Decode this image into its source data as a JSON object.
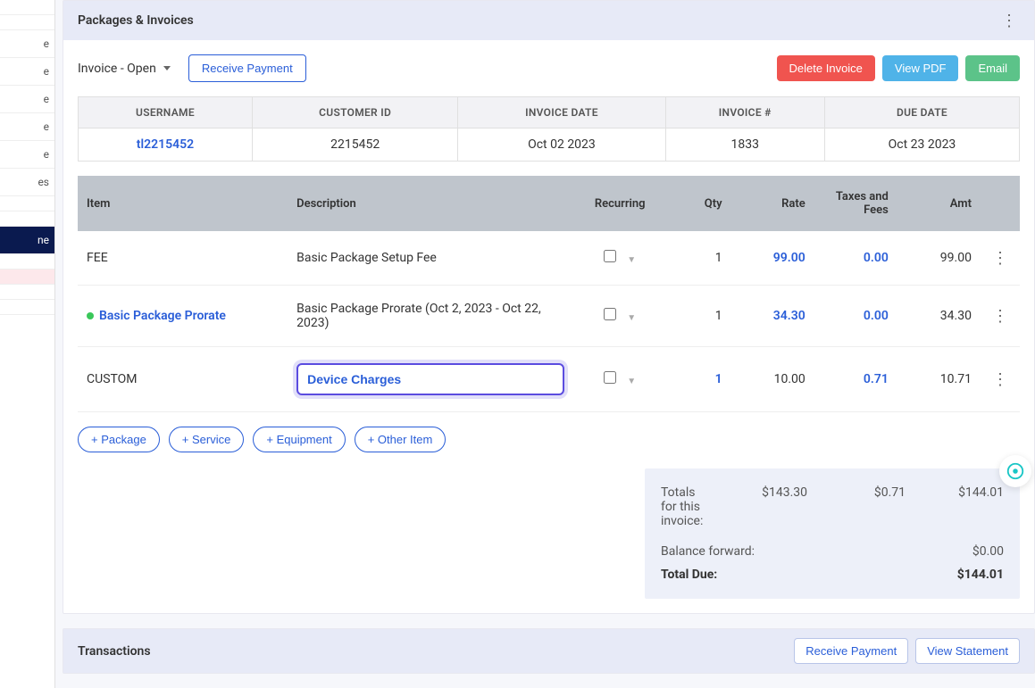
{
  "sidebar": {
    "items": [
      "",
      "",
      "e",
      "e",
      "e",
      "e",
      "e",
      "es",
      "",
      "",
      "ne",
      "",
      "",
      "",
      ""
    ]
  },
  "panel": {
    "title": "Packages & Invoices"
  },
  "toolbar": {
    "invoice_status": "Invoice - Open",
    "receive_payment": "Receive Payment",
    "delete_invoice": "Delete Invoice",
    "view_pdf": "View PDF",
    "email": "Email"
  },
  "info": {
    "headers": {
      "username": "USERNAME",
      "customer_id": "CUSTOMER ID",
      "invoice_date": "INVOICE DATE",
      "invoice_no": "INVOICE #",
      "due_date": "DUE DATE"
    },
    "values": {
      "username": "tl2215452",
      "customer_id": "2215452",
      "invoice_date": "Oct 02 2023",
      "invoice_no": "1833",
      "due_date": "Oct 23 2023"
    }
  },
  "items": {
    "headers": {
      "item": "Item",
      "description": "Description",
      "recurring": "Recurring",
      "qty": "Qty",
      "rate": "Rate",
      "taxes": "Taxes and Fees",
      "amt": "Amt"
    },
    "rows": [
      {
        "item": "FEE",
        "desc": "Basic Package Setup Fee",
        "recurring": false,
        "qty": "1",
        "rate": "99.00",
        "taxes": "0.00",
        "amt": "99.00",
        "rate_link": true,
        "taxes_link": true,
        "qty_link": false,
        "is_link_item": false
      },
      {
        "item": "Basic Package Prorate",
        "desc": "Basic Package Prorate (Oct 2, 2023 - Oct 22, 2023)",
        "recurring": false,
        "qty": "1",
        "rate": "34.30",
        "taxes": "0.00",
        "amt": "34.30",
        "rate_link": true,
        "taxes_link": true,
        "qty_link": false,
        "is_link_item": true
      },
      {
        "item": "CUSTOM",
        "desc": "Device Charges",
        "recurring": false,
        "qty": "1",
        "rate": "10.00",
        "taxes": "0.71",
        "amt": "10.71",
        "rate_link": false,
        "taxes_link": true,
        "qty_link": true,
        "is_link_item": false,
        "editing": true
      }
    ]
  },
  "add_buttons": {
    "package": "+ Package",
    "service": "+ Service",
    "equipment": "+ Equipment",
    "other": "+ Other Item"
  },
  "totals": {
    "label_totals": "Totals for this invoice:",
    "subtotal": "$143.30",
    "tax": "$0.71",
    "total": "$144.01",
    "balance_label": "Balance forward:",
    "balance": "$0.00",
    "due_label": "Total Due:",
    "due": "$144.01"
  },
  "transactions": {
    "title": "Transactions",
    "receive": "Receive Payment",
    "statement": "View Statement"
  }
}
